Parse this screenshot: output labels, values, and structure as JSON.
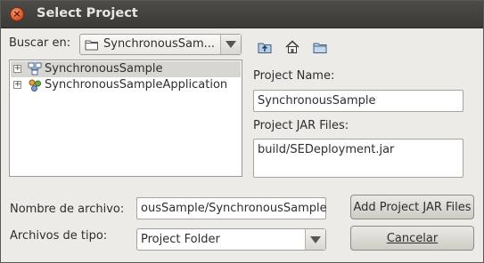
{
  "window": {
    "title": "Select Project",
    "close_glyph": "×"
  },
  "lookin": {
    "label": "Buscar en:",
    "value": "SynchronousSam..."
  },
  "toolbar": {
    "icons": [
      "up-folder-icon",
      "home-icon",
      "new-folder-icon"
    ]
  },
  "tree": {
    "items": [
      {
        "label": "SynchronousSample",
        "icon": "project-icon",
        "selected": true
      },
      {
        "label": "SynchronousSampleApplication",
        "icon": "application-icon",
        "selected": false
      }
    ]
  },
  "project": {
    "name_label": "Project Name:",
    "name_value": "SynchronousSample",
    "jars_label": "Project JAR Files:",
    "jars_value": "build/SEDeployment.jar"
  },
  "filename": {
    "label": "Nombre de archivo:",
    "value": "ousSample/SynchronousSample"
  },
  "filetype": {
    "label": "Archivos de tipo:",
    "value": "Project Folder"
  },
  "buttons": {
    "add_jar": "Add Project JAR Files",
    "cancel": "Cancelar"
  },
  "colors": {
    "titlebar": "#3c3b37",
    "dialog_bg": "#edebe8",
    "close_button": "#df5a2b"
  }
}
